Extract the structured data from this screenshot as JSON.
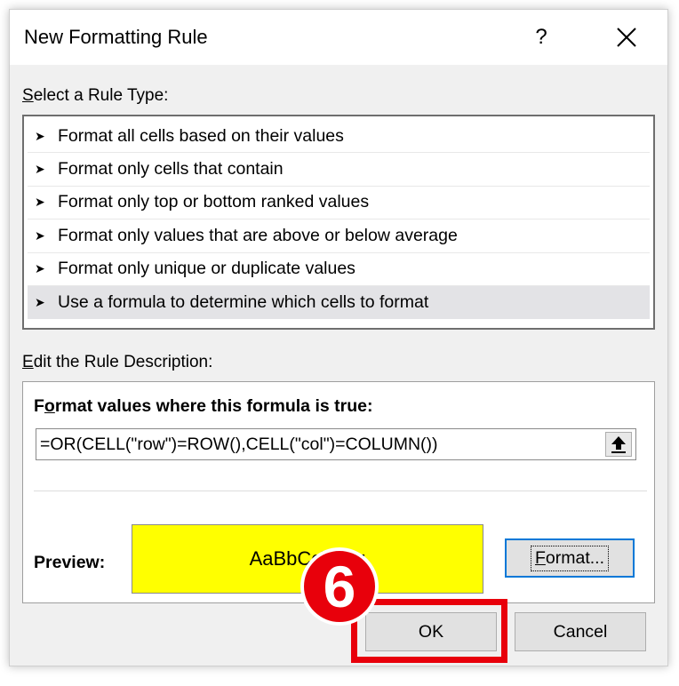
{
  "dialog": {
    "title": "New Formatting Rule",
    "help_glyph": "?",
    "close_glyph": "✕"
  },
  "rule_type": {
    "label_accel": "S",
    "label_rest": "elect a Rule Type:",
    "items": [
      {
        "label": "Format all cells based on their values",
        "selected": false
      },
      {
        "label": "Format only cells that contain",
        "selected": false
      },
      {
        "label": "Format only top or bottom ranked values",
        "selected": false
      },
      {
        "label": "Format only values that are above or below average",
        "selected": false
      },
      {
        "label": "Format only unique or duplicate values",
        "selected": false
      },
      {
        "label": "Use a formula to determine which cells to format",
        "selected": true
      }
    ],
    "arrow_glyph": "➤"
  },
  "description": {
    "label_accel": "E",
    "label_rest": "dit the Rule Description:",
    "format_heading_pre": "F",
    "format_heading_accel": "o",
    "format_heading_rest": "rmat values where this formula is true:",
    "formula": "=OR(CELL(\"row\")=ROW(),CELL(\"col\")=COLUMN())",
    "preview_label": "Preview:",
    "preview_text": "AaBbCcYyZz",
    "preview_color": "#ffff00",
    "format_button_accel": "F",
    "format_button_rest": "ormat..."
  },
  "buttons": {
    "ok": "OK",
    "cancel": "Cancel"
  },
  "annotation": {
    "step": "6",
    "color": "#e8000b"
  }
}
